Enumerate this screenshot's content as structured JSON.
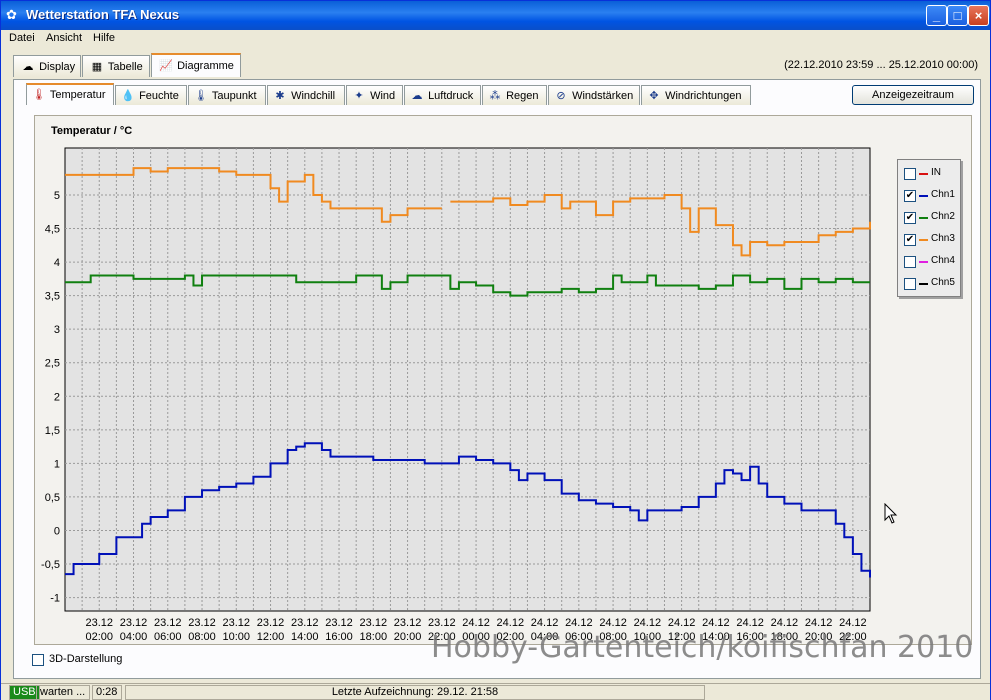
{
  "window": {
    "title": "Wetterstation TFA Nexus"
  },
  "menu": [
    "Datei",
    "Ansicht",
    "Hilfe"
  ],
  "main_tabs": [
    {
      "label": "Display",
      "icon": "display-icon"
    },
    {
      "label": "Tabelle",
      "icon": "table-icon"
    },
    {
      "label": "Diagramme",
      "icon": "chart-icon"
    }
  ],
  "date_range": "(22.12.2010 23:59 ... 25.12.2010 00:00)",
  "sub_tabs": [
    {
      "label": "Temperatur",
      "icon": "thermometer-icon"
    },
    {
      "label": "Feuchte",
      "icon": "humidity-icon"
    },
    {
      "label": "Taupunkt",
      "icon": "dewpoint-icon"
    },
    {
      "label": "Windchill",
      "icon": "windchill-icon"
    },
    {
      "label": "Wind",
      "icon": "wind-icon"
    },
    {
      "label": "Luftdruck",
      "icon": "pressure-icon"
    },
    {
      "label": "Regen",
      "icon": "rain-icon"
    },
    {
      "label": "Windstärken",
      "icon": "wind-strength-icon"
    },
    {
      "label": "Windrichtungen",
      "icon": "wind-direction-icon"
    }
  ],
  "range_button": "Anzeigezeitraum",
  "checkbox_3d": "3D-Darstellung",
  "watermark": "Hobby-Gartenteich/koifischfan 2010",
  "status": {
    "usb": "USB",
    "state": "warten ...",
    "time": "0:28",
    "last_record": "Letzte Aufzeichnung: 29.12. 21:58"
  },
  "legend": [
    {
      "name": "IN",
      "color": "#d81010",
      "checked": false
    },
    {
      "name": "Chn1",
      "color": "#0010b8",
      "checked": true
    },
    {
      "name": "Chn2",
      "color": "#108010",
      "checked": true
    },
    {
      "name": "Chn3",
      "color": "#f08a20",
      "checked": true
    },
    {
      "name": "Chn4",
      "color": "#e020e0",
      "checked": false
    },
    {
      "name": "Chn5",
      "color": "#000000",
      "checked": false
    }
  ],
  "chart_data": {
    "type": "line",
    "title": "Temperatur / °C",
    "ylim": [
      -1.2,
      5.7
    ],
    "yticks": [
      "-1",
      "-0,5",
      "0",
      "0,5",
      "1",
      "1,5",
      "2",
      "2,5",
      "3",
      "3,5",
      "4",
      "4,5",
      "5"
    ],
    "xlim": [
      0,
      47
    ],
    "xticks": [
      {
        "date": "23.12",
        "time": "02:00"
      },
      {
        "date": "23.12",
        "time": "04:00"
      },
      {
        "date": "23.12",
        "time": "06:00"
      },
      {
        "date": "23.12",
        "time": "08:00"
      },
      {
        "date": "23.12",
        "time": "10:00"
      },
      {
        "date": "23.12",
        "time": "12:00"
      },
      {
        "date": "23.12",
        "time": "14:00"
      },
      {
        "date": "23.12",
        "time": "16:00"
      },
      {
        "date": "23.12",
        "time": "18:00"
      },
      {
        "date": "23.12",
        "time": "20:00"
      },
      {
        "date": "23.12",
        "time": "22:00"
      },
      {
        "date": "24.12",
        "time": "00:00"
      },
      {
        "date": "24.12",
        "time": "02:00"
      },
      {
        "date": "24.12",
        "time": "04:00"
      },
      {
        "date": "24.12",
        "time": "06:00"
      },
      {
        "date": "24.12",
        "time": "08:00"
      },
      {
        "date": "24.12",
        "time": "10:00"
      },
      {
        "date": "24.12",
        "time": "12:00"
      },
      {
        "date": "24.12",
        "time": "14:00"
      },
      {
        "date": "24.12",
        "time": "16:00"
      },
      {
        "date": "24.12",
        "time": "18:00"
      },
      {
        "date": "24.12",
        "time": "20:00"
      },
      {
        "date": "24.12",
        "time": "22:00"
      }
    ],
    "grid": true,
    "series": [
      {
        "name": "Chn1",
        "color": "#0010b8",
        "points": [
          [
            0,
            -0.65
          ],
          [
            0.5,
            -0.5
          ],
          [
            1.5,
            -0.5
          ],
          [
            2,
            -0.35
          ],
          [
            3,
            -0.1
          ],
          [
            4,
            -0.1
          ],
          [
            4.5,
            0.1
          ],
          [
            5,
            0.2
          ],
          [
            6,
            0.3
          ],
          [
            7,
            0.5
          ],
          [
            8,
            0.6
          ],
          [
            9,
            0.65
          ],
          [
            10,
            0.7
          ],
          [
            11,
            0.8
          ],
          [
            12,
            1.0
          ],
          [
            13,
            1.2
          ],
          [
            13.5,
            1.25
          ],
          [
            14,
            1.3
          ],
          [
            15,
            1.2
          ],
          [
            15.5,
            1.1
          ],
          [
            17,
            1.1
          ],
          [
            18,
            1.05
          ],
          [
            20,
            1.05
          ],
          [
            21,
            1.0
          ],
          [
            23,
            1.1
          ],
          [
            24,
            1.05
          ],
          [
            25,
            1.0
          ],
          [
            26,
            0.9
          ],
          [
            26.5,
            0.75
          ],
          [
            27,
            0.85
          ],
          [
            28,
            0.75
          ],
          [
            29,
            0.55
          ],
          [
            30,
            0.45
          ],
          [
            31,
            0.4
          ],
          [
            32,
            0.35
          ],
          [
            33,
            0.3
          ],
          [
            33.5,
            0.15
          ],
          [
            34,
            0.3
          ],
          [
            35,
            0.3
          ],
          [
            36,
            0.35
          ],
          [
            37,
            0.5
          ],
          [
            38,
            0.7
          ],
          [
            38.5,
            0.9
          ],
          [
            39,
            0.85
          ],
          [
            39.5,
            0.75
          ],
          [
            40,
            0.95
          ],
          [
            40.5,
            0.7
          ],
          [
            41,
            0.5
          ],
          [
            42,
            0.4
          ],
          [
            43,
            0.3
          ],
          [
            44,
            0.3
          ],
          [
            45,
            0.1
          ],
          [
            45.5,
            -0.1
          ],
          [
            46,
            -0.35
          ],
          [
            46.5,
            -0.6
          ],
          [
            47,
            -0.7
          ]
        ]
      },
      {
        "name": "Chn2",
        "color": "#108010",
        "points": [
          [
            0,
            3.7
          ],
          [
            1.5,
            3.8
          ],
          [
            3,
            3.8
          ],
          [
            4,
            3.75
          ],
          [
            7,
            3.8
          ],
          [
            7.5,
            3.65
          ],
          [
            8,
            3.8
          ],
          [
            13,
            3.8
          ],
          [
            13.5,
            3.7
          ],
          [
            16,
            3.7
          ],
          [
            17,
            3.8
          ],
          [
            18,
            3.8
          ],
          [
            18.5,
            3.6
          ],
          [
            19,
            3.7
          ],
          [
            20,
            3.8
          ],
          [
            22,
            3.8
          ],
          [
            22.5,
            3.6
          ],
          [
            23,
            3.7
          ],
          [
            24,
            3.65
          ],
          [
            25,
            3.55
          ],
          [
            26,
            3.5
          ],
          [
            27,
            3.55
          ],
          [
            28,
            3.55
          ],
          [
            29,
            3.6
          ],
          [
            30,
            3.55
          ],
          [
            31,
            3.6
          ],
          [
            32,
            3.8
          ],
          [
            32.5,
            3.7
          ],
          [
            33,
            3.7
          ],
          [
            34,
            3.8
          ],
          [
            34.5,
            3.65
          ],
          [
            36,
            3.65
          ],
          [
            37,
            3.6
          ],
          [
            38,
            3.65
          ],
          [
            39,
            3.8
          ],
          [
            40,
            3.7
          ],
          [
            41,
            3.75
          ],
          [
            42,
            3.6
          ],
          [
            43,
            3.75
          ],
          [
            44,
            3.7
          ],
          [
            45,
            3.75
          ],
          [
            46,
            3.7
          ],
          [
            47,
            3.7
          ]
        ]
      },
      {
        "name": "Chn3",
        "color": "#f08a20",
        "points": [
          [
            0,
            5.3
          ],
          [
            3.5,
            5.3
          ],
          [
            4,
            5.4
          ],
          [
            5,
            5.35
          ],
          [
            6,
            5.4
          ],
          [
            9,
            5.35
          ],
          [
            10,
            5.3
          ],
          [
            12,
            5.3
          ],
          [
            12,
            5.1
          ],
          [
            12.5,
            4.9
          ],
          [
            13,
            5.2
          ],
          [
            14,
            5.3
          ],
          [
            14.5,
            5.0
          ],
          [
            15,
            4.9
          ],
          [
            15.5,
            4.8
          ],
          [
            18,
            4.8
          ],
          [
            18.5,
            4.6
          ],
          [
            19,
            4.7
          ],
          [
            20,
            4.8
          ],
          [
            22,
            4.8
          ]
        ]
      },
      {
        "name": "Chn3b",
        "color": "#f08a20",
        "points": [
          [
            22.5,
            4.9
          ],
          [
            25,
            4.95
          ],
          [
            26,
            4.85
          ],
          [
            27,
            4.9
          ],
          [
            28,
            5.0
          ],
          [
            29,
            4.8
          ],
          [
            29.5,
            4.9
          ],
          [
            31,
            4.7
          ],
          [
            32,
            4.9
          ],
          [
            33,
            4.95
          ],
          [
            35,
            5.0
          ],
          [
            36,
            4.8
          ],
          [
            36.5,
            4.45
          ],
          [
            37,
            4.8
          ],
          [
            38,
            4.55
          ],
          [
            39,
            4.25
          ],
          [
            39.5,
            4.1
          ],
          [
            40,
            4.3
          ],
          [
            41,
            4.25
          ],
          [
            42,
            4.3
          ],
          [
            43,
            4.3
          ],
          [
            44,
            4.4
          ],
          [
            45,
            4.45
          ],
          [
            46,
            4.5
          ],
          [
            47,
            4.6
          ]
        ]
      }
    ]
  }
}
